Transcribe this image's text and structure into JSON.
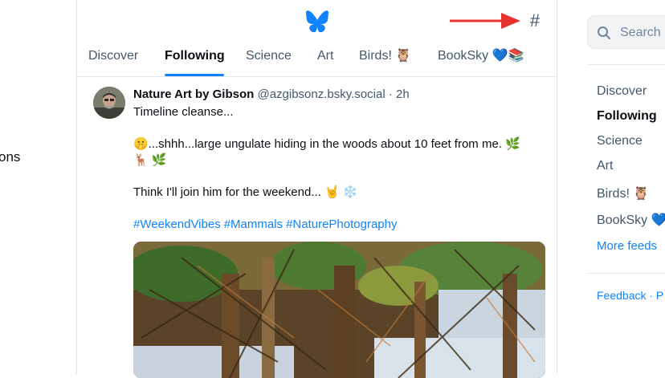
{
  "left": {
    "partial_text": "ons"
  },
  "header": {
    "logo_icon": "bluesky-butterfly-icon",
    "hash_label": "#",
    "hash_icon": "hashtag-icon"
  },
  "tabs": [
    {
      "label": "Discover"
    },
    {
      "label": "Following"
    },
    {
      "label": "Science"
    },
    {
      "label": "Art"
    },
    {
      "label": "Birds! 🦉"
    },
    {
      "label": "BookSky 💙📚"
    }
  ],
  "post": {
    "author_name": "Nature Art by Gibson",
    "handle": "@azgibsonz.bsky.social",
    "separator": "·",
    "time": "2h",
    "line1": "Timeline cleanse...",
    "line2": "🤫...shhh...large ungulate hiding in the woods about 10 feet from me. 🌿",
    "line3": "🦌 🌿",
    "line4": "Think I'll join him for the weekend... 🤘 ❄️",
    "hashtags": [
      "#WeekendVibes",
      "#Mammals",
      "#NaturePhotography"
    ]
  },
  "sidebar": {
    "search_placeholder": "Search",
    "feeds": [
      {
        "label": "Discover"
      },
      {
        "label": "Following"
      },
      {
        "label": "Science"
      },
      {
        "label": "Art"
      },
      {
        "label": "Birds! 🦉"
      },
      {
        "label": "BookSky 💙"
      }
    ],
    "more_feeds": "More feeds",
    "footer": "Feedback · P"
  },
  "colors": {
    "accent": "#1083fe",
    "arrow": "#e5322d",
    "muted": "#42576c"
  }
}
